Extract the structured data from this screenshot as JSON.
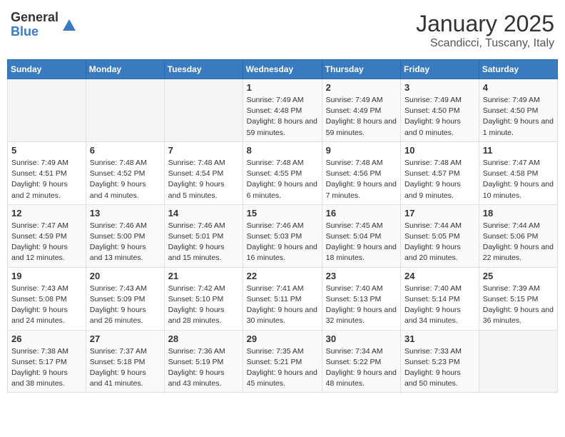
{
  "header": {
    "logo_general": "General",
    "logo_blue": "Blue",
    "month_title": "January 2025",
    "subtitle": "Scandicci, Tuscany, Italy"
  },
  "weekdays": [
    "Sunday",
    "Monday",
    "Tuesday",
    "Wednesday",
    "Thursday",
    "Friday",
    "Saturday"
  ],
  "weeks": [
    [
      {
        "day": "",
        "info": ""
      },
      {
        "day": "",
        "info": ""
      },
      {
        "day": "",
        "info": ""
      },
      {
        "day": "1",
        "info": "Sunrise: 7:49 AM\nSunset: 4:48 PM\nDaylight: 8 hours and 59 minutes."
      },
      {
        "day": "2",
        "info": "Sunrise: 7:49 AM\nSunset: 4:49 PM\nDaylight: 8 hours and 59 minutes."
      },
      {
        "day": "3",
        "info": "Sunrise: 7:49 AM\nSunset: 4:50 PM\nDaylight: 9 hours and 0 minutes."
      },
      {
        "day": "4",
        "info": "Sunrise: 7:49 AM\nSunset: 4:50 PM\nDaylight: 9 hours and 1 minute."
      }
    ],
    [
      {
        "day": "5",
        "info": "Sunrise: 7:49 AM\nSunset: 4:51 PM\nDaylight: 9 hours and 2 minutes."
      },
      {
        "day": "6",
        "info": "Sunrise: 7:48 AM\nSunset: 4:52 PM\nDaylight: 9 hours and 4 minutes."
      },
      {
        "day": "7",
        "info": "Sunrise: 7:48 AM\nSunset: 4:54 PM\nDaylight: 9 hours and 5 minutes."
      },
      {
        "day": "8",
        "info": "Sunrise: 7:48 AM\nSunset: 4:55 PM\nDaylight: 9 hours and 6 minutes."
      },
      {
        "day": "9",
        "info": "Sunrise: 7:48 AM\nSunset: 4:56 PM\nDaylight: 9 hours and 7 minutes."
      },
      {
        "day": "10",
        "info": "Sunrise: 7:48 AM\nSunset: 4:57 PM\nDaylight: 9 hours and 9 minutes."
      },
      {
        "day": "11",
        "info": "Sunrise: 7:47 AM\nSunset: 4:58 PM\nDaylight: 9 hours and 10 minutes."
      }
    ],
    [
      {
        "day": "12",
        "info": "Sunrise: 7:47 AM\nSunset: 4:59 PM\nDaylight: 9 hours and 12 minutes."
      },
      {
        "day": "13",
        "info": "Sunrise: 7:46 AM\nSunset: 5:00 PM\nDaylight: 9 hours and 13 minutes."
      },
      {
        "day": "14",
        "info": "Sunrise: 7:46 AM\nSunset: 5:01 PM\nDaylight: 9 hours and 15 minutes."
      },
      {
        "day": "15",
        "info": "Sunrise: 7:46 AM\nSunset: 5:03 PM\nDaylight: 9 hours and 16 minutes."
      },
      {
        "day": "16",
        "info": "Sunrise: 7:45 AM\nSunset: 5:04 PM\nDaylight: 9 hours and 18 minutes."
      },
      {
        "day": "17",
        "info": "Sunrise: 7:44 AM\nSunset: 5:05 PM\nDaylight: 9 hours and 20 minutes."
      },
      {
        "day": "18",
        "info": "Sunrise: 7:44 AM\nSunset: 5:06 PM\nDaylight: 9 hours and 22 minutes."
      }
    ],
    [
      {
        "day": "19",
        "info": "Sunrise: 7:43 AM\nSunset: 5:08 PM\nDaylight: 9 hours and 24 minutes."
      },
      {
        "day": "20",
        "info": "Sunrise: 7:43 AM\nSunset: 5:09 PM\nDaylight: 9 hours and 26 minutes."
      },
      {
        "day": "21",
        "info": "Sunrise: 7:42 AM\nSunset: 5:10 PM\nDaylight: 9 hours and 28 minutes."
      },
      {
        "day": "22",
        "info": "Sunrise: 7:41 AM\nSunset: 5:11 PM\nDaylight: 9 hours and 30 minutes."
      },
      {
        "day": "23",
        "info": "Sunrise: 7:40 AM\nSunset: 5:13 PM\nDaylight: 9 hours and 32 minutes."
      },
      {
        "day": "24",
        "info": "Sunrise: 7:40 AM\nSunset: 5:14 PM\nDaylight: 9 hours and 34 minutes."
      },
      {
        "day": "25",
        "info": "Sunrise: 7:39 AM\nSunset: 5:15 PM\nDaylight: 9 hours and 36 minutes."
      }
    ],
    [
      {
        "day": "26",
        "info": "Sunrise: 7:38 AM\nSunset: 5:17 PM\nDaylight: 9 hours and 38 minutes."
      },
      {
        "day": "27",
        "info": "Sunrise: 7:37 AM\nSunset: 5:18 PM\nDaylight: 9 hours and 41 minutes."
      },
      {
        "day": "28",
        "info": "Sunrise: 7:36 AM\nSunset: 5:19 PM\nDaylight: 9 hours and 43 minutes."
      },
      {
        "day": "29",
        "info": "Sunrise: 7:35 AM\nSunset: 5:21 PM\nDaylight: 9 hours and 45 minutes."
      },
      {
        "day": "30",
        "info": "Sunrise: 7:34 AM\nSunset: 5:22 PM\nDaylight: 9 hours and 48 minutes."
      },
      {
        "day": "31",
        "info": "Sunrise: 7:33 AM\nSunset: 5:23 PM\nDaylight: 9 hours and 50 minutes."
      },
      {
        "day": "",
        "info": ""
      }
    ]
  ]
}
